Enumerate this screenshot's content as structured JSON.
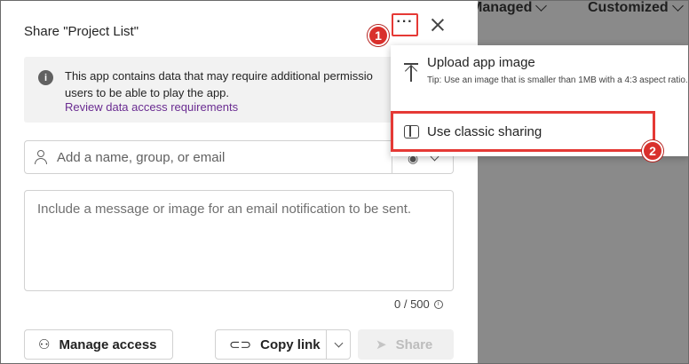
{
  "background": {
    "column_headers": [
      "Managed",
      "Customized"
    ]
  },
  "dialog": {
    "title": "Share \"Project List\"",
    "more_label": "···",
    "info": {
      "line1": "This app contains data that may require additional permissio",
      "line2": "users to be able to play the app.",
      "link": "Review data access requirements",
      "icon": "info-icon"
    },
    "people_input": {
      "placeholder": "Add a name, group, or email"
    },
    "message": {
      "placeholder": "Include a message or image for an email notification to be sent."
    },
    "char_count": "0 / 500",
    "buttons": {
      "manage_access": "Manage access",
      "copy_link": "Copy link",
      "share": "Share"
    }
  },
  "menu": {
    "upload_label": "Upload app image",
    "upload_tip": "Tip: Use an image that is smaller than 1MB with a 4:3 aspect ratio.",
    "classic_label": "Use classic sharing"
  },
  "callouts": [
    "1",
    "2"
  ],
  "colors": {
    "highlight": "#e53935",
    "badge": "#d9302c",
    "link": "#6a2c91"
  }
}
